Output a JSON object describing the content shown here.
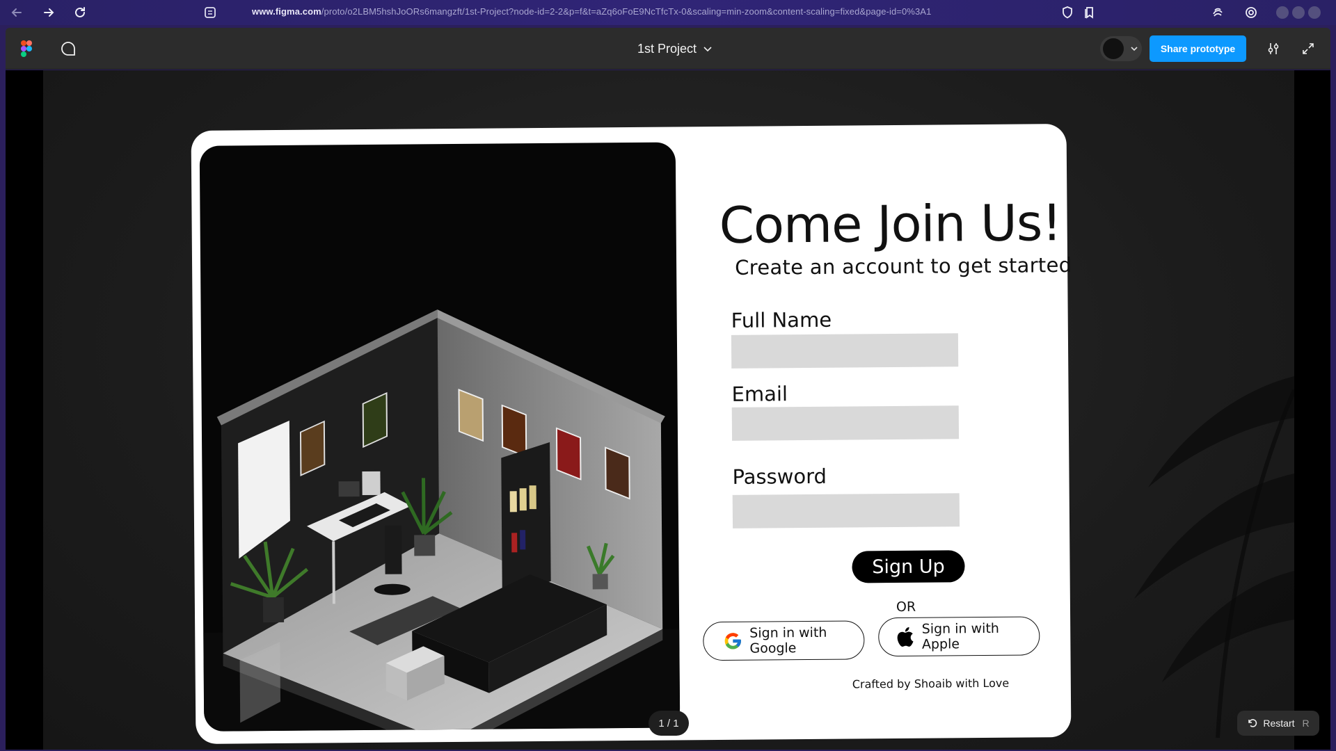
{
  "browser": {
    "url_domain": "www.figma.com",
    "url_path": "/proto/o2LBM5hshJoORs6mangzft/1st-Project?node-id=2-2&p=f&t=aZq6oFoE9NcTfcTx-0&scaling=min-zoom&content-scaling=fixed&page-id=0%3A1",
    "icons": [
      "back-arrow-icon",
      "forward-arrow-icon",
      "reload-icon",
      "reader-icon",
      "shield-icon",
      "bookmark-icon",
      "extensions-icon",
      "target-icon"
    ]
  },
  "figma": {
    "project_title": "1st Project",
    "share_label": "Share prototype",
    "avatar_initial": "",
    "page_counter": "1 / 1",
    "restart_label": "Restart",
    "restart_key": "R"
  },
  "form": {
    "title": "Come Join Us!",
    "subtitle": "Create an account to get started",
    "fields": [
      {
        "label": "Full Name",
        "value": ""
      },
      {
        "label": "Email",
        "value": ""
      },
      {
        "label": "Password",
        "value": ""
      }
    ],
    "signup_label": "Sign Up",
    "or_label": "OR",
    "google_label": "Sign in with Google",
    "apple_label": "Sign in  with Apple",
    "footer": "Crafted by Shoaib with Love"
  },
  "colors": {
    "figma_bar": "#2c2c2c",
    "share_button": "#0d99ff",
    "browser_bar": "#2a2166",
    "input_bg": "#d9d9d9",
    "signup_bg": "#000000"
  }
}
